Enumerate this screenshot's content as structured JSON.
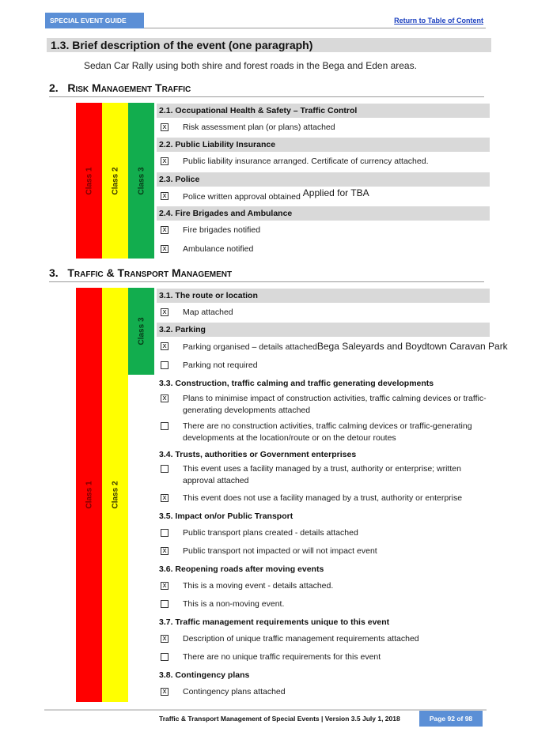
{
  "header": {
    "guide_label": "SPECIAL EVENT GUIDE",
    "toc_link": "Return to Table of Content"
  },
  "section_1_3": {
    "title": "1.3.  Brief description of the event (one paragraph)",
    "description": "Sedan Car Rally using both shire and forest roads in the Bega and Eden areas."
  },
  "section_2": {
    "number": "2.",
    "title": "Risk Management Traffic",
    "class_labels": [
      "Class 1",
      "Class 2",
      "Class 3"
    ],
    "groups": [
      {
        "title": "2.1. Occupational Health & Safety – Traffic Control",
        "items": [
          {
            "checked": true,
            "mark": "x",
            "text": "Risk assessment plan (or plans) attached",
            "note": ""
          }
        ]
      },
      {
        "title": "2.2. Public Liability Insurance",
        "items": [
          {
            "checked": true,
            "mark": "x",
            "text": "Public liability insurance arranged.  Certificate of currency attached.",
            "note": ""
          }
        ]
      },
      {
        "title": "2.3. Police",
        "items": [
          {
            "checked": true,
            "mark": "x",
            "text": "Police written approval  obtained",
            "note": "Applied for TBA"
          }
        ]
      },
      {
        "title": "2.4. Fire Brigades and Ambulance",
        "items": [
          {
            "checked": true,
            "mark": "x",
            "text": "Fire brigades notified",
            "note": ""
          },
          {
            "checked": true,
            "mark": "x",
            "text": "Ambulance notified",
            "note": ""
          }
        ]
      }
    ]
  },
  "section_3": {
    "number": "3.",
    "title": "Traffic & Transport Management",
    "class_labels": [
      "Class 1",
      "Class 2",
      "Class 3"
    ],
    "groups": [
      {
        "title": "3.1. The route or location",
        "items": [
          {
            "checked": true,
            "mark": "x",
            "text": "Map attached",
            "note": ""
          }
        ]
      },
      {
        "title": "3.2. Parking",
        "items": [
          {
            "checked": true,
            "mark": "x",
            "text": "Parking organised – details attached",
            "note": "Bega Saleyards and Boydtown Caravan Park"
          },
          {
            "checked": false,
            "mark": "",
            "text": "Parking not required",
            "note": ""
          }
        ]
      },
      {
        "title": "3.3. Construction, traffic calming and traffic generating developments",
        "items": [
          {
            "checked": true,
            "mark": "x",
            "text": "Plans to minimise impact of construction activities, traffic calming devices or traffic-generating   developments attached",
            "note": ""
          },
          {
            "checked": false,
            "mark": "",
            "text": "There are no construction activities, traffic calming devices or traffic-generating developments at   the location/route or on the detour routes",
            "note": ""
          }
        ]
      },
      {
        "title": "3.4. Trusts, authorities or Government enterprises",
        "items": [
          {
            "checked": false,
            "mark": "",
            "text": "This event uses a facility managed by a trust, authority or enterprise; written approval attached",
            "note": ""
          },
          {
            "checked": true,
            "mark": "x",
            "text": "This event does not use a facility managed by a trust, authority or enterprise",
            "note": ""
          }
        ]
      },
      {
        "title": "3.5. Impact on/or Public Transport",
        "items": [
          {
            "checked": false,
            "mark": "",
            "text": "Public transport plans created - details attached",
            "note": ""
          },
          {
            "checked": true,
            "mark": "x",
            "text": "Public transport not impacted or will not impact event",
            "note": ""
          }
        ]
      },
      {
        "title": "3.6. Reopening roads after moving events",
        "items": [
          {
            "checked": true,
            "mark": "x",
            "text": "This is a moving event - details attached.",
            "note": ""
          },
          {
            "checked": false,
            "mark": "",
            "text": "This is a non-moving event.",
            "note": ""
          }
        ]
      },
      {
        "title": "3.7. Traffic management requirements unique to this event",
        "items": [
          {
            "checked": true,
            "mark": "x",
            "text": "Description of unique traffic management requirements attached",
            "note": ""
          },
          {
            "checked": false,
            "mark": "",
            "text": "There are no unique traffic requirements for this event",
            "note": ""
          }
        ]
      },
      {
        "title": "3.8. Contingency plans",
        "items": [
          {
            "checked": true,
            "mark": "x",
            "text": "Contingency plans attached",
            "note": ""
          }
        ]
      }
    ]
  },
  "footer": {
    "doc_title": "Traffic & Transport Management of Special Events | Version 3.5 July 1, 2018",
    "page": "Page 92 of 98"
  },
  "colors": {
    "class1": "#ff0000",
    "class2": "#ffff00",
    "class3": "#12ad4e",
    "header_blue": "#5b8fd6",
    "row_header_gray": "#d9d9d9"
  }
}
